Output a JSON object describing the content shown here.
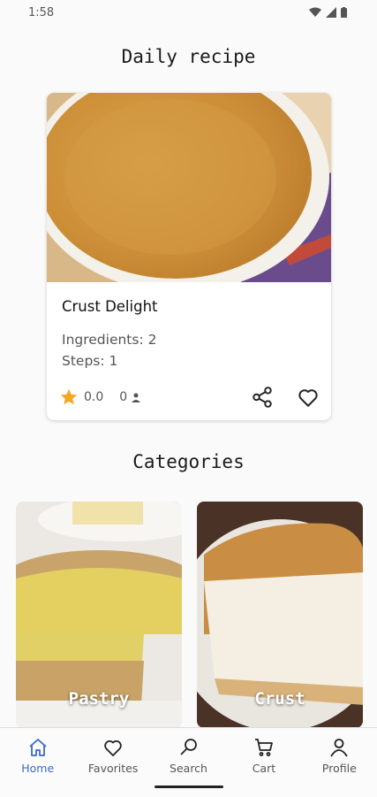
{
  "status_bar": {
    "time": "1:58"
  },
  "daily": {
    "title": "Daily recipe",
    "recipe": {
      "name": "Crust Delight",
      "ingredients_text": "Ingredients: 2",
      "steps_text": "Steps: 1",
      "rating": "0.0",
      "people": "0"
    }
  },
  "categories": {
    "title": "Categories",
    "items": [
      {
        "label": "Pastry"
      },
      {
        "label": "Crust"
      }
    ]
  },
  "nav": {
    "items": [
      {
        "label": "Home",
        "icon": "home-icon",
        "active": true
      },
      {
        "label": "Favorites",
        "icon": "heart-icon",
        "active": false
      },
      {
        "label": "Search",
        "icon": "search-icon",
        "active": false
      },
      {
        "label": "Cart",
        "icon": "cart-icon",
        "active": false
      },
      {
        "label": "Profile",
        "icon": "person-icon",
        "active": false
      }
    ]
  },
  "colors": {
    "accent": "#3a6bc4",
    "star": "#f5a623"
  }
}
